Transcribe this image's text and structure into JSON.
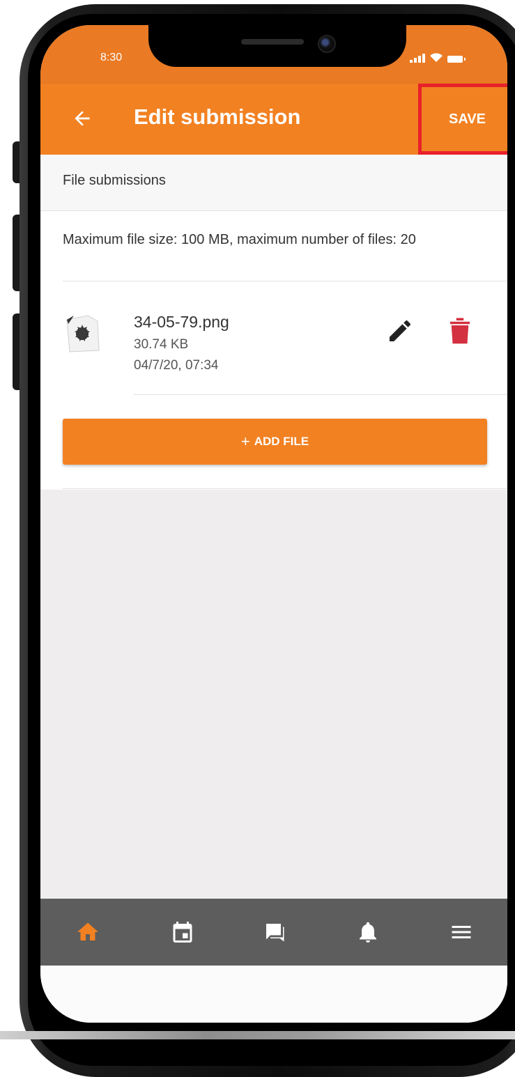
{
  "status_bar": {
    "time": "8:30"
  },
  "app_bar": {
    "title": "Edit submission",
    "save_label": "SAVE",
    "back_icon": "arrow-left-icon"
  },
  "section": {
    "header": "File submissions"
  },
  "limits": {
    "text": "Maximum file size: 100 MB, maximum number of files: 20"
  },
  "files": [
    {
      "name": "34-05-79.png",
      "size": "30.74 KB",
      "date": "04/7/20, 07:34",
      "icon": "image-file-icon",
      "actions": [
        "pencil-icon",
        "trash-icon"
      ]
    }
  ],
  "add_file": {
    "label": "ADD FILE",
    "icon": "plus-icon"
  },
  "bottom_nav": {
    "items": [
      {
        "icon": "home-icon",
        "active": true
      },
      {
        "icon": "calendar-icon",
        "active": false
      },
      {
        "icon": "messages-icon",
        "active": false
      },
      {
        "icon": "bell-icon",
        "active": false
      },
      {
        "icon": "menu-icon",
        "active": false
      }
    ]
  },
  "colors": {
    "primary": "#f28122",
    "status_bar": "#ea7a24",
    "delete": "#d3313f",
    "nav_bg": "#5d5d5d",
    "highlight_box": "#e8202a"
  }
}
